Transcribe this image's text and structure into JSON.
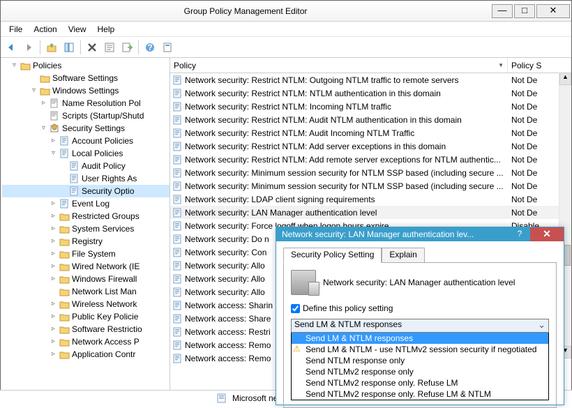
{
  "window": {
    "title": "Group Policy Management Editor"
  },
  "menus": [
    "File",
    "Action",
    "View",
    "Help"
  ],
  "tree_root": "Policies",
  "tree": [
    {
      "ind": 2,
      "tw": "",
      "ic": "folder",
      "label": "Software Settings"
    },
    {
      "ind": 2,
      "tw": "▿",
      "ic": "folder",
      "label": "Windows Settings"
    },
    {
      "ind": 3,
      "tw": "▹",
      "ic": "scroll",
      "label": "Name Resolution Pol"
    },
    {
      "ind": 3,
      "tw": "",
      "ic": "scroll",
      "label": "Scripts (Startup/Shutd"
    },
    {
      "ind": 3,
      "tw": "▿",
      "ic": "sec",
      "label": "Security Settings"
    },
    {
      "ind": 4,
      "tw": "▹",
      "ic": "doc",
      "label": "Account Policies"
    },
    {
      "ind": 4,
      "tw": "▿",
      "ic": "doc",
      "label": "Local Policies"
    },
    {
      "ind": 5,
      "tw": "",
      "ic": "doc",
      "label": "Audit Policy"
    },
    {
      "ind": 5,
      "tw": "",
      "ic": "doc",
      "label": "User Rights As"
    },
    {
      "ind": 5,
      "tw": "",
      "ic": "doc",
      "label": "Security Optio",
      "sel": true
    },
    {
      "ind": 4,
      "tw": "▹",
      "ic": "doc",
      "label": "Event Log"
    },
    {
      "ind": 4,
      "tw": "▹",
      "ic": "folder",
      "label": "Restricted Groups"
    },
    {
      "ind": 4,
      "tw": "▹",
      "ic": "folder",
      "label": "System Services"
    },
    {
      "ind": 4,
      "tw": "▹",
      "ic": "folder",
      "label": "Registry"
    },
    {
      "ind": 4,
      "tw": "▹",
      "ic": "folder",
      "label": "File System"
    },
    {
      "ind": 4,
      "tw": "▹",
      "ic": "folder",
      "label": "Wired Network (IE"
    },
    {
      "ind": 4,
      "tw": "▹",
      "ic": "folder",
      "label": "Windows Firewall"
    },
    {
      "ind": 4,
      "tw": "",
      "ic": "folder",
      "label": "Network List Man"
    },
    {
      "ind": 4,
      "tw": "▹",
      "ic": "folder",
      "label": "Wireless Network"
    },
    {
      "ind": 4,
      "tw": "▹",
      "ic": "folder",
      "label": "Public Key Policie"
    },
    {
      "ind": 4,
      "tw": "▹",
      "ic": "folder",
      "label": "Software Restrictio"
    },
    {
      "ind": 4,
      "tw": "▹",
      "ic": "folder",
      "label": "Network Access P"
    },
    {
      "ind": 4,
      "tw": "▹",
      "ic": "folder",
      "label": "Application Contr"
    }
  ],
  "list_headers": {
    "policy": "Policy",
    "setting": "Policy S"
  },
  "policies": [
    {
      "name": "Network security: Restrict NTLM: Outgoing NTLM traffic to remote servers",
      "val": "Not De"
    },
    {
      "name": "Network security: Restrict NTLM: NTLM authentication in this domain",
      "val": "Not De"
    },
    {
      "name": "Network security: Restrict NTLM: Incoming NTLM traffic",
      "val": "Not De"
    },
    {
      "name": "Network security: Restrict NTLM: Audit NTLM authentication in this domain",
      "val": "Not De"
    },
    {
      "name": "Network security: Restrict NTLM: Audit Incoming NTLM Traffic",
      "val": "Not De"
    },
    {
      "name": "Network security: Restrict NTLM: Add server exceptions in this domain",
      "val": "Not De"
    },
    {
      "name": "Network security: Restrict NTLM: Add remote server exceptions for NTLM authentic...",
      "val": "Not De"
    },
    {
      "name": "Network security: Minimum session security for NTLM SSP based (including secure ...",
      "val": "Not De"
    },
    {
      "name": "Network security: Minimum session security for NTLM SSP based (including secure ...",
      "val": "Not De"
    },
    {
      "name": "Network security: LDAP client signing requirements",
      "val": "Not De"
    },
    {
      "name": "Network security: LAN Manager authentication level",
      "val": "Not De",
      "hl": true
    },
    {
      "name": "Network security: Force logoff when logon hours expire",
      "val": "Disable"
    },
    {
      "name": "Network security: Do n",
      "val": ""
    },
    {
      "name": "Network security: Con",
      "val": ""
    },
    {
      "name": "Network security: Allo",
      "val": ""
    },
    {
      "name": "Network security: Allo",
      "val": ""
    },
    {
      "name": "Network security: Allo",
      "val": ""
    },
    {
      "name": "Network access: Sharin",
      "val": ""
    },
    {
      "name": "Network access: Share",
      "val": ""
    },
    {
      "name": "Network access: Restri",
      "val": ""
    },
    {
      "name": "Network access: Remo",
      "val": ""
    },
    {
      "name": "Network access: Remo",
      "val": ""
    }
  ],
  "dlg": {
    "title": "Network security: LAN Manager authentication lev...",
    "tabs": [
      "Security Policy Setting",
      "Explain"
    ],
    "heading": "Network security: LAN Manager authentication level",
    "checkbox": "Define this policy setting",
    "selected": "Send LM & NTLM responses",
    "options": [
      {
        "t": "Send LM & NTLM responses",
        "sel": true
      },
      {
        "t": "Send LM & NTLM - use NTLMv2 session security if negotiated",
        "warn": true
      },
      {
        "t": "Send NTLM response only"
      },
      {
        "t": "Send NTLMv2 response only"
      },
      {
        "t": "Send NTLMv2 response only. Refuse LM"
      },
      {
        "t": "Send NTLMv2 response only. Refuse LM & NTLM"
      }
    ]
  },
  "status": "Microsoft netw"
}
